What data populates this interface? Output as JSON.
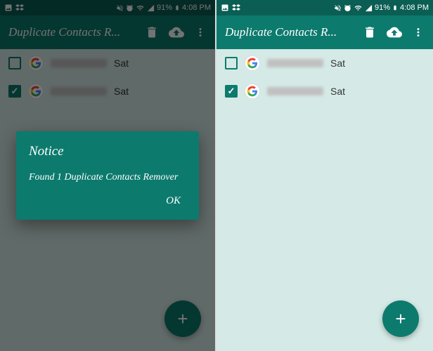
{
  "status_bar": {
    "battery_pct": "91%",
    "time": "4:08 PM"
  },
  "app_bar": {
    "title": "Duplicate Contacts R..."
  },
  "contacts": [
    {
      "day": "Sat",
      "checked": false
    },
    {
      "day": "Sat",
      "checked": true
    }
  ],
  "dialog": {
    "title": "Notice",
    "message": "Found 1 Duplicate Contacts Remover",
    "ok": "OK"
  },
  "fab": {
    "label": "+"
  }
}
